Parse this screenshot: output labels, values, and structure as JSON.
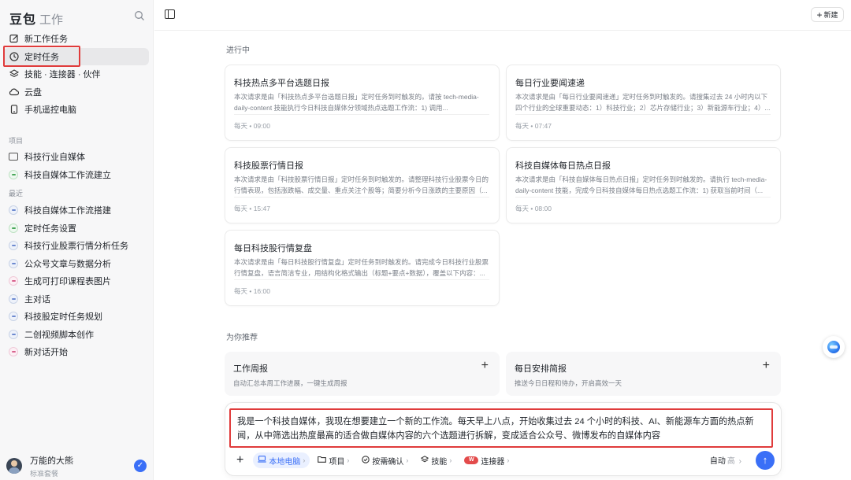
{
  "sidebar": {
    "brand": "豆包",
    "brand_sub": "工作",
    "nav": [
      {
        "label": "新工作任务",
        "icon": "edit-icon"
      },
      {
        "label": "定时任务",
        "icon": "clock-icon"
      },
      {
        "label": "技能 · 连接器 · 伙伴",
        "icon": "layers-icon"
      },
      {
        "label": "云盘",
        "icon": "cloud-icon"
      },
      {
        "label": "手机遥控电脑",
        "icon": "phone-icon"
      }
    ],
    "projects_label": "项目",
    "projects": [
      {
        "label": "科技行业自媒体",
        "icon": "folder-icon"
      },
      {
        "label": "科技自媒体工作流建立",
        "icon": "chat-icon"
      }
    ],
    "recent_label": "最近",
    "recent": [
      {
        "label": "科技自媒体工作流搭建",
        "icon": "chat-icon"
      },
      {
        "label": "定时任务设置",
        "icon": "chat-icon"
      },
      {
        "label": "科技行业股票行情分析任务",
        "icon": "chat-icon"
      },
      {
        "label": "公众号文章与数据分析",
        "icon": "chat-icon"
      },
      {
        "label": "生成可打印课程表图片",
        "icon": "chat-icon"
      },
      {
        "label": "主对话",
        "icon": "chat-icon"
      },
      {
        "label": "科技股定时任务规划",
        "icon": "chat-icon"
      },
      {
        "label": "二创视频脚本创作",
        "icon": "chat-icon"
      },
      {
        "label": "新对话开始",
        "icon": "chat-icon"
      }
    ],
    "user": {
      "name": "万能的大熊",
      "plan": "标准套餐"
    }
  },
  "topbar": {
    "new_label": "新建"
  },
  "main": {
    "in_progress_label": "进行中",
    "tasks": [
      {
        "title": "科技热点多平台选题日报",
        "desc": "本次请求是由「科技热点多平台选题日报」定时任务到时触发的。请按 tech-media-daily-content 技能执行今日科技自媒体分领域热点选题工作流：1) 调用...",
        "time": "每天 • 09:00"
      },
      {
        "title": "每日行业要闻速递",
        "desc": "本次请求是由「每日行业要闻速递」定时任务到时触发的。请搜集过去 24 小时内以下四个行业的全球重要动态：1）科技行业；2）芯片存储行业；3）新能源车行业；4）...",
        "time": "每天 • 07:47"
      },
      {
        "title": "科技股票行情日报",
        "desc": "本次请求是由「科技股票行情日报」定时任务到时触发的。请整理科技行业股票今日的行情表现，包括涨跌幅、成交量、重点关注个股等；简要分析今日涨跌的主要原因（...",
        "time": "每天 • 15:47"
      },
      {
        "title": "科技自媒体每日热点日报",
        "desc": "本次请求是由「科技自媒体每日热点日报」定时任务到时触发的。请执行 tech-media-daily-content 技能，完成今日科技自媒体每日热点选题工作流：1) 获取当前时间（...",
        "time": "每天 • 08:00"
      },
      {
        "title": "每日科技股行情复盘",
        "desc": "本次请求是由「每日科技股行情复盘」定时任务到时触发的。请完成今日科技行业股票行情复盘，语言简洁专业，用结构化格式输出（标题+要点+数据），覆盖以下内容：...",
        "time": "每天 • 16:00"
      }
    ],
    "recommend_label": "为你推荐",
    "recommendations": [
      {
        "title": "工作周报",
        "desc": "自动汇总本周工作进展，一键生成周报"
      },
      {
        "title": "每日安排简报",
        "desc": "推送今日日程和待办，开启高效一天"
      }
    ]
  },
  "composer": {
    "prompt": "我是一个科技自媒体，我现在想要建立一个新的工作流。每天早上八点，开始收集过去 24 个小时的科技、AI、新能源车方面的热点新闻，从中筛选出热度最高的适合做自媒体内容的六个选题进行拆解，变成适合公众号、微博发布的自媒体内容",
    "tools": [
      {
        "label": "本地电脑",
        "icon": "laptop-icon"
      },
      {
        "label": "项目",
        "icon": "folder-icon"
      },
      {
        "label": "按需确认",
        "icon": "check-circle-icon"
      },
      {
        "label": "技能",
        "icon": "layers-icon"
      },
      {
        "label": "连接器",
        "icon": "wps-icon"
      }
    ],
    "mode": "自动",
    "mode_level": "高"
  },
  "colors": {
    "accent": "#3a6ff7",
    "highlight": "#e03b3b",
    "sidebar_bg": "#f7f7f8"
  }
}
